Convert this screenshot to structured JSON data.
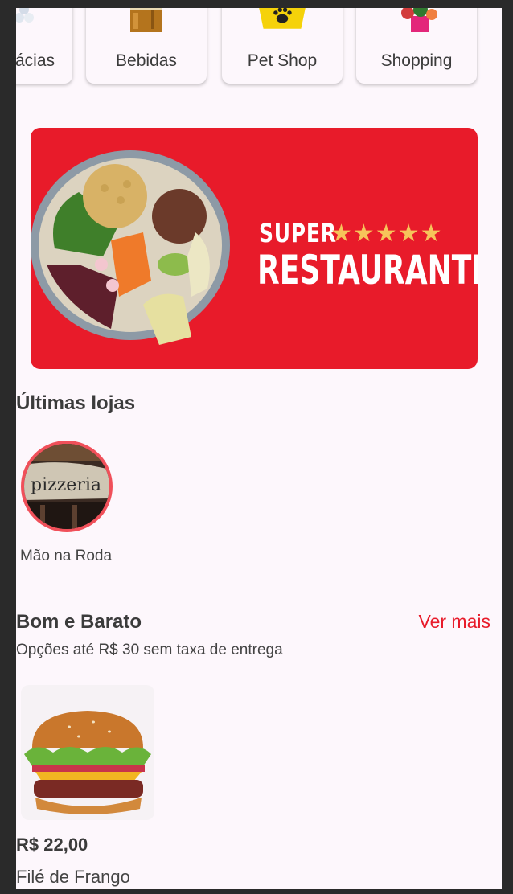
{
  "categories": [
    {
      "label": "ácias",
      "icon": "pharmacy-icon"
    },
    {
      "label": "Bebidas",
      "icon": "beer-icon"
    },
    {
      "label": "Pet Shop",
      "icon": "pet-bucket-icon"
    },
    {
      "label": "Shopping",
      "icon": "flowers-icon"
    }
  ],
  "banner": {
    "line1": "SUPER",
    "stars": "★★★★★",
    "line2": "RESTAURANTES"
  },
  "recent_stores": {
    "title": "Últimas lojas",
    "items": [
      {
        "name": "Mão na Roda",
        "image_text": "pizzeria"
      }
    ]
  },
  "bom_barato": {
    "title": "Bom e Barato",
    "see_more": "Ver mais",
    "subtitle": "Opções até R$ 30 sem taxa de entrega",
    "items": [
      {
        "price": "R$ 22,00",
        "name": "Filé de Frango"
      }
    ]
  },
  "colors": {
    "accent": "#e81b2a",
    "background": "#fdf7fc",
    "store_ring": "#f0505a"
  }
}
